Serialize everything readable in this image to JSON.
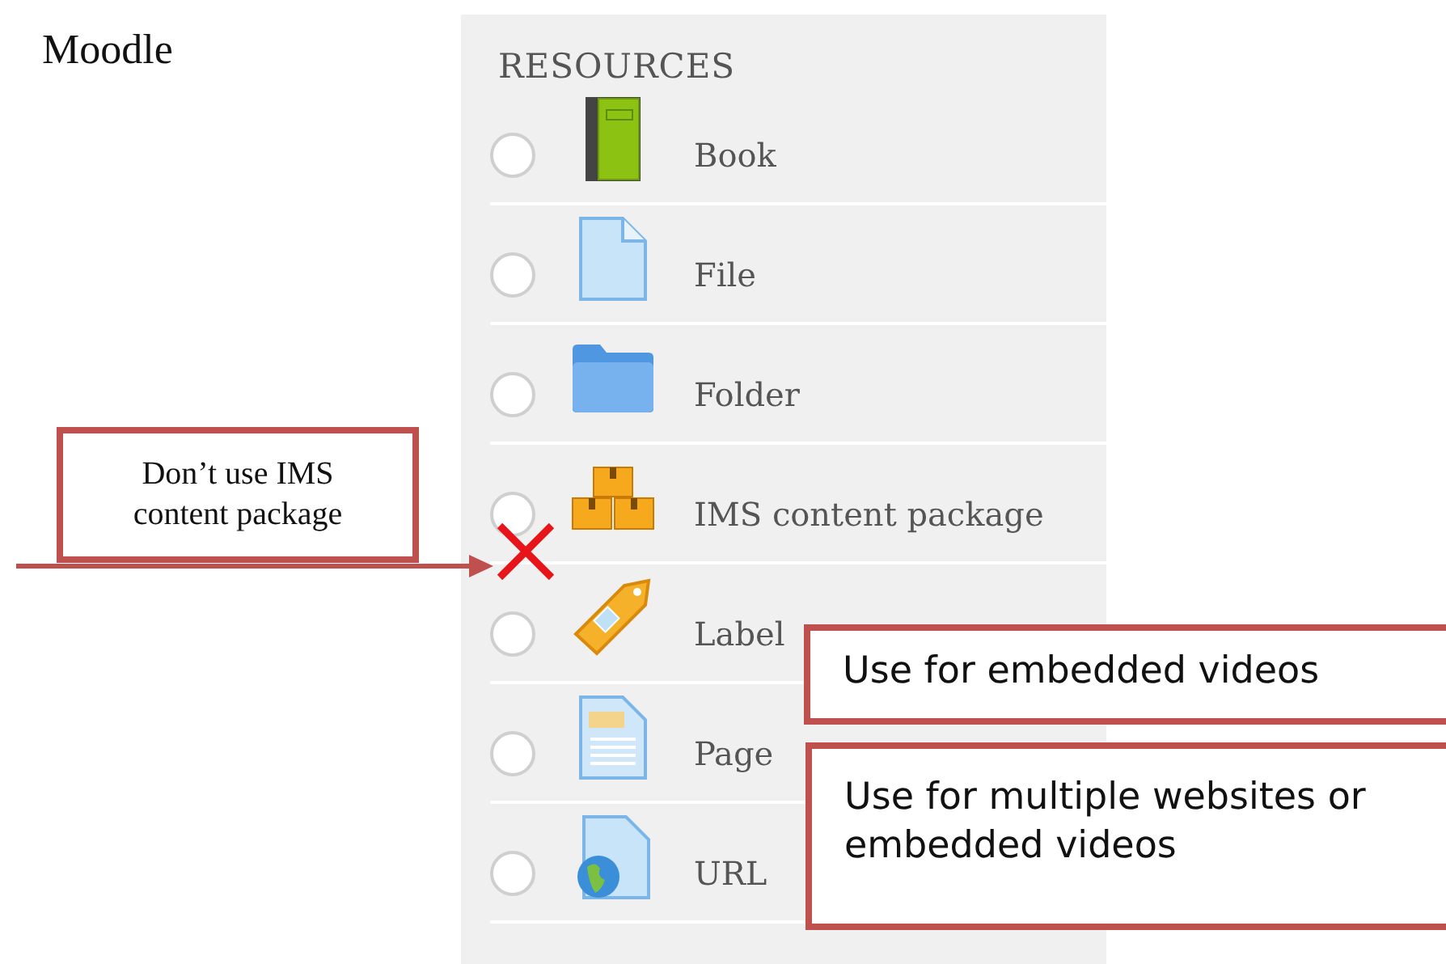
{
  "page_heading": "Moodle",
  "panel": {
    "heading": "RESOURCES",
    "items": [
      {
        "label": "Book",
        "kind": "book",
        "selected": false,
        "struck": false
      },
      {
        "label": "File",
        "kind": "file",
        "selected": false,
        "struck": false
      },
      {
        "label": "Folder",
        "kind": "folder",
        "selected": false,
        "struck": false
      },
      {
        "label": "IMS content package",
        "kind": "package",
        "selected": false,
        "struck": true
      },
      {
        "label": "Label",
        "kind": "label",
        "selected": false,
        "struck": false
      },
      {
        "label": "Page",
        "kind": "page",
        "selected": false,
        "struck": false
      },
      {
        "label": "URL",
        "kind": "url",
        "selected": false,
        "struck": false
      }
    ]
  },
  "callouts": [
    {
      "text": "Don’t use IMS content package",
      "kind": "pointer"
    },
    {
      "text": "Use for embedded videos",
      "kind": "note"
    },
    {
      "text": "Use for multiple websites or embedded videos",
      "kind": "note"
    }
  ]
}
